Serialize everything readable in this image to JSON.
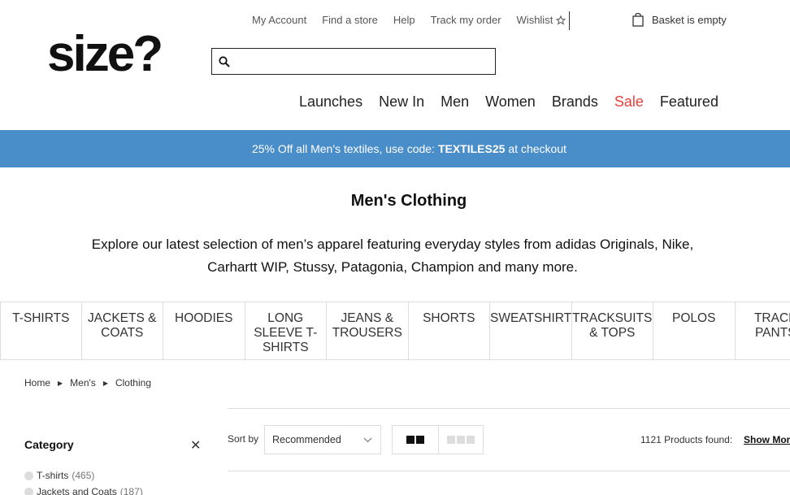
{
  "header": {
    "top_links": [
      "My Account",
      "Find a store",
      "Help",
      "Track my order"
    ],
    "wishlist_label": "Wishlist",
    "basket_label": "Basket is empty",
    "logo": "size?",
    "search_placeholder": ""
  },
  "main_nav": [
    "Launches",
    "New In",
    "Men",
    "Women",
    "Brands",
    "Sale",
    "Featured"
  ],
  "promo": {
    "prefix": "25% Off all Men's textiles, use code:",
    "code": "TEXTILES25",
    "suffix": "at checkout",
    "bg_color": "#4a8ec9"
  },
  "page": {
    "title": "Men's Clothing",
    "intro": "Explore our latest selection of men’s apparel featuring everyday styles from adidas Originals, Nike, Carhartt WIP, Stussy, Patagonia, Champion and many more."
  },
  "categories": [
    "T-Shirts",
    "Jackets & Coats",
    "Hoodies",
    "Long Sleeve T-Shirts",
    "Jeans & Trousers",
    "Shorts",
    "Sweatshirts",
    "Tracksuits & Tops",
    "Polos",
    "Track Pants"
  ],
  "breadcrumb": [
    "Home",
    "Men's",
    "Clothing"
  ],
  "filters": {
    "title": "Category",
    "items": [
      {
        "label": "T-shirts",
        "count": "(465)"
      },
      {
        "label": "Jackets and Coats",
        "count": "(187)"
      }
    ]
  },
  "toolbar": {
    "sort_label": "Sort by",
    "sort_value": "Recommended",
    "products_found": "1121 Products found:",
    "show_more": "Show More"
  },
  "colors": {
    "sale": "#e8403b"
  }
}
